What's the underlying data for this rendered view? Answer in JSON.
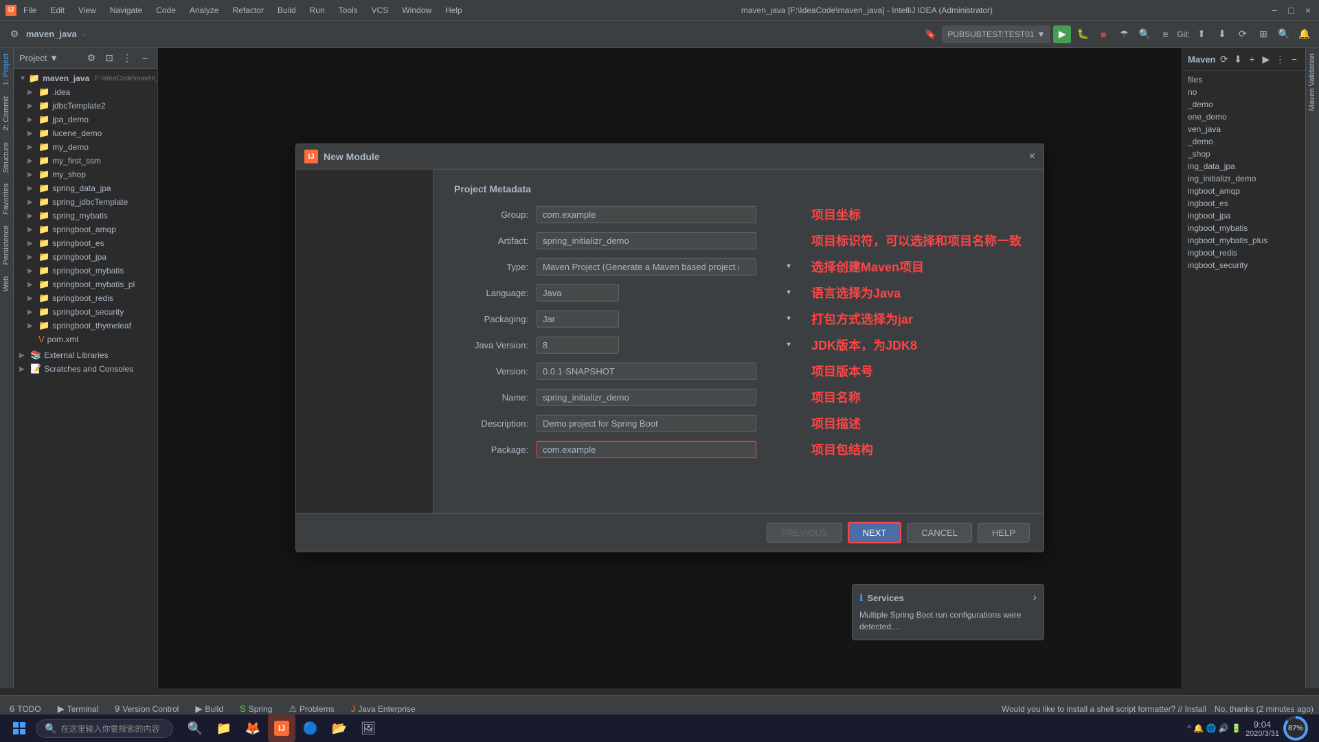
{
  "titlebar": {
    "icon": "IJ",
    "menu_items": [
      "File",
      "Edit",
      "View",
      "Navigate",
      "Code",
      "Analyze",
      "Refactor",
      "Build",
      "Run",
      "Tools",
      "VCS",
      "Window",
      "Help"
    ],
    "title": "maven_java [F:\\IdeaCode\\maven_java] - IntelliJ IDEA (Administrator)",
    "minimize": "−",
    "maximize": "□",
    "close": "×"
  },
  "toolbar": {
    "project_name": "maven_java",
    "arrow": "›",
    "run_config": "PUBSUBTEST:TEST01",
    "maven_label": "Maven"
  },
  "project_panel": {
    "title": "Project",
    "root_name": "maven_java",
    "root_path": "F:\\IdeaCode\\maven_java",
    "items": [
      {
        "name": ".idea",
        "indent": 1
      },
      {
        "name": "jdbcTemplate2",
        "indent": 1
      },
      {
        "name": "jpa_demo",
        "indent": 1
      },
      {
        "name": "lucene_demo",
        "indent": 1
      },
      {
        "name": "my_demo",
        "indent": 1
      },
      {
        "name": "my_first_ssm",
        "indent": 1
      },
      {
        "name": "my_shop",
        "indent": 1
      },
      {
        "name": "spring_data_jpa",
        "indent": 1
      },
      {
        "name": "spring_jdbcTemplate",
        "indent": 1
      },
      {
        "name": "spring_mybatis",
        "indent": 1
      },
      {
        "name": "springboot_amqp",
        "indent": 1
      },
      {
        "name": "springboot_es",
        "indent": 1
      },
      {
        "name": "springboot_jpa",
        "indent": 1
      },
      {
        "name": "springboot_mybatis",
        "indent": 1
      },
      {
        "name": "springboot_mybatis_pl",
        "indent": 1
      },
      {
        "name": "springboot_redis",
        "indent": 1
      },
      {
        "name": "springboot_security",
        "indent": 1
      },
      {
        "name": "springboot_thymeleaf",
        "indent": 1
      },
      {
        "name": "pom.xml",
        "indent": 1
      },
      {
        "name": "External Libraries",
        "indent": 0
      },
      {
        "name": "Scratches and Consoles",
        "indent": 0
      }
    ]
  },
  "modal": {
    "title": "New Module",
    "logo": "IJ",
    "section_title": "Project Metadata",
    "fields": {
      "group_label": "Group:",
      "group_value": "com.example",
      "artifact_label": "Artifact:",
      "artifact_value": "spring_initializr_demo",
      "type_label": "Type:",
      "type_value": "Maven Project (Generate a Maven based project archive.)",
      "language_label": "Language:",
      "language_value": "Java",
      "packaging_label": "Packaging:",
      "packaging_value": "Jar",
      "java_version_label": "Java Version:",
      "java_version_value": "8",
      "version_label": "Version:",
      "version_value": "0.0.1-SNAPSHOT",
      "name_label": "Name:",
      "name_value": "spring_initializr_demo",
      "description_label": "Description:",
      "description_value": "Demo project for Spring Boot",
      "package_label": "Package:",
      "package_value": "com.example"
    },
    "annotations": {
      "group": "项目坐标",
      "artifact": "项目标识符，可以选择和项目名称一致",
      "type": "选择创建Maven项目",
      "language": "语言选择为Java",
      "packaging": "打包方式选择为jar",
      "java_version": "JDK版本，为JDK8",
      "version": "项目版本号",
      "name": "项目名称",
      "description": "项目描述",
      "package": "项目包结构"
    },
    "buttons": {
      "previous": "PREVIOUS",
      "next": "NEXT",
      "cancel": "CANCEL",
      "help": "HELP"
    }
  },
  "maven_sidebar": {
    "title": "Maven",
    "items": [
      "files",
      "no",
      "_demo",
      "ene_demo",
      "ven_java",
      "_demo",
      "_shop",
      "ing_data_jpa",
      "ing_initializr_demo",
      "ingboot_amqp",
      "ingboot_es",
      "ingboot_jpa",
      "ingboot_mybatis",
      "ingboot_mybatis_plus",
      "ingboot_redis",
      "ingboot_security"
    ]
  },
  "bottom_tabs": [
    {
      "icon": "6",
      "label": "TODO"
    },
    {
      "icon": "▶",
      "label": "Terminal"
    },
    {
      "icon": "9",
      "label": "Version Control"
    },
    {
      "icon": "▶",
      "label": "Build"
    },
    {
      "icon": "S",
      "label": "Spring"
    },
    {
      "icon": "⚠",
      "label": "Problems"
    },
    {
      "icon": "J",
      "label": "Java Enterprise"
    }
  ],
  "status_bar": {
    "message": "Would you like to install a shell script formatter? // Install",
    "time_info": "No, thanks (2 minutes ago)"
  },
  "services_popup": {
    "title": "Services",
    "text": "Multiple Spring Boot run configurations were detected....",
    "more": "›"
  },
  "taskbar": {
    "search_placeholder": "在这里输入你要搜索的内容",
    "time": "9:04",
    "date": "2020/3/31",
    "battery": "87%"
  }
}
